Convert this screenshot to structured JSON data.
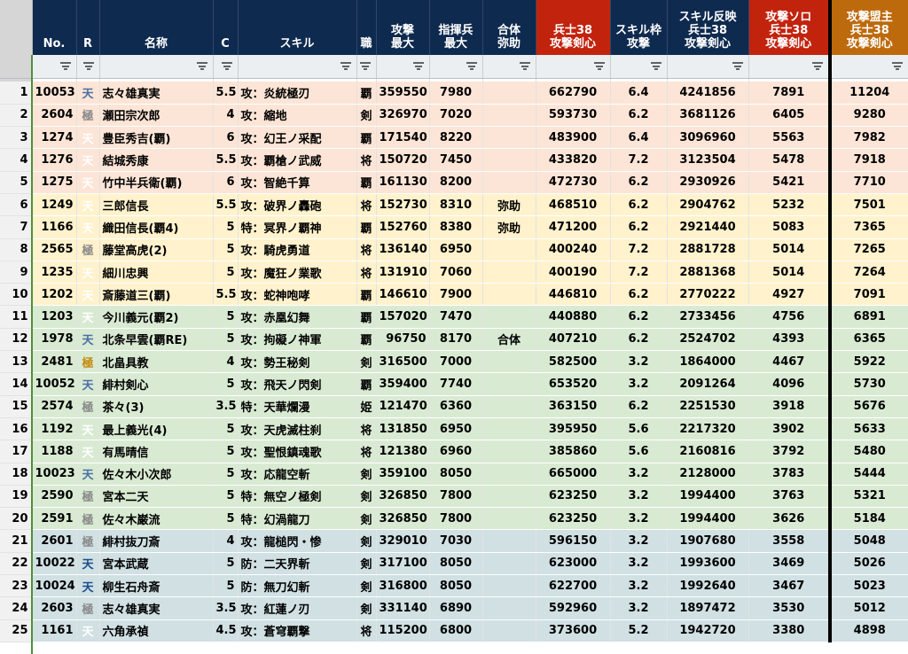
{
  "columns": [
    {
      "key": "no",
      "label": "No."
    },
    {
      "key": "r",
      "label": "R"
    },
    {
      "key": "name",
      "label": "名称"
    },
    {
      "key": "c",
      "label": "C"
    },
    {
      "key": "skill",
      "label": "スキル"
    },
    {
      "key": "job",
      "label": "職"
    },
    {
      "key": "atk_max",
      "label": "攻撃\n最大"
    },
    {
      "key": "cmd_max",
      "label": "指揮兵\n最大"
    },
    {
      "key": "combo",
      "label": "合体\n弥助"
    },
    {
      "key": "sol38",
      "label": "兵士38\n攻撃剣心"
    },
    {
      "key": "skill_slot",
      "label": "スキル枠\n攻撃"
    },
    {
      "key": "skill_reflect",
      "label": "スキル反映\n兵士38\n攻撃剣心"
    },
    {
      "key": "solo",
      "label": "攻撃ソロ\n兵士38\n攻撃剣心"
    },
    {
      "key": "alliance",
      "label": "攻撃盟主\n兵士38\n攻撃剣心"
    }
  ],
  "header_colors": {
    "default": "#0e2a4f",
    "red": "#c2230d",
    "orange": "#bd6a0d"
  },
  "rows": [
    {
      "n": "1",
      "no": "10053",
      "r": "天",
      "rs": "ten",
      "name": "志々雄真実",
      "c": "5.5",
      "skill": "攻：炎統極刃",
      "job": "覇",
      "atk": "359550",
      "cmd": "7980",
      "combo": "",
      "s38": "662790",
      "slot": "6.4",
      "refl": "4241856",
      "solo": "7891",
      "ally": "11204",
      "g": "g1"
    },
    {
      "n": "2",
      "no": "2604",
      "r": "極",
      "rs": "kyoku",
      "name": "瀬田宗次郎",
      "c": "4",
      "skill": "攻：縮地",
      "job": "剣",
      "atk": "326970",
      "cmd": "7020",
      "combo": "",
      "s38": "593730",
      "slot": "6.2",
      "refl": "3681126",
      "solo": "6405",
      "ally": "9280",
      "g": "g1"
    },
    {
      "n": "3",
      "no": "1274",
      "r": "天",
      "rs": "tenw",
      "name": "豊臣秀吉(覇)",
      "c": "6",
      "skill": "攻：幻王ノ采配",
      "job": "覇",
      "atk": "171540",
      "cmd": "8220",
      "combo": "",
      "s38": "483900",
      "slot": "6.4",
      "refl": "3096960",
      "solo": "5563",
      "ally": "7982",
      "g": "g1"
    },
    {
      "n": "4",
      "no": "1276",
      "r": "天",
      "rs": "tenw",
      "name": "結城秀康",
      "c": "5.5",
      "skill": "攻：覇槍ノ武威",
      "job": "将",
      "atk": "150720",
      "cmd": "7450",
      "combo": "",
      "s38": "433820",
      "slot": "7.2",
      "refl": "3123504",
      "solo": "5478",
      "ally": "7918",
      "g": "g1"
    },
    {
      "n": "5",
      "no": "1275",
      "r": "天",
      "rs": "tenw",
      "name": "竹中半兵衛(覇)",
      "c": "6",
      "skill": "攻：智絶千算",
      "job": "覇",
      "atk": "161130",
      "cmd": "8200",
      "combo": "",
      "s38": "472730",
      "slot": "6.2",
      "refl": "2930926",
      "solo": "5421",
      "ally": "7710",
      "g": "g1"
    },
    {
      "n": "6",
      "no": "1249",
      "r": "天",
      "rs": "tenw",
      "name": "三郎信長",
      "c": "5.5",
      "skill": "攻：破界ノ轟砲",
      "job": "将",
      "atk": "152730",
      "cmd": "8310",
      "combo": "弥助",
      "s38": "468510",
      "slot": "6.2",
      "refl": "2904762",
      "solo": "5232",
      "ally": "7501",
      "g": "g2"
    },
    {
      "n": "7",
      "no": "1166",
      "r": "天",
      "rs": "tenw",
      "name": "織田信長(覇4)",
      "c": "5",
      "skill": "特：冥界ノ覇神",
      "job": "覇",
      "atk": "152760",
      "cmd": "8380",
      "combo": "弥助",
      "s38": "471200",
      "slot": "6.2",
      "refl": "2921440",
      "solo": "5083",
      "ally": "7365",
      "g": "g2"
    },
    {
      "n": "8",
      "no": "2565",
      "r": "極",
      "rs": "kyoku",
      "name": "藤堂高虎(2)",
      "c": "5",
      "skill": "攻：騎虎勇道",
      "job": "将",
      "atk": "136140",
      "cmd": "6950",
      "combo": "",
      "s38": "400240",
      "slot": "7.2",
      "refl": "2881728",
      "solo": "5014",
      "ally": "7265",
      "g": "g2"
    },
    {
      "n": "9",
      "no": "1235",
      "r": "天",
      "rs": "tenw",
      "name": "細川忠興",
      "c": "5",
      "skill": "攻：魔狂ノ業歌",
      "job": "将",
      "atk": "131910",
      "cmd": "7060",
      "combo": "",
      "s38": "400190",
      "slot": "7.2",
      "refl": "2881368",
      "solo": "5014",
      "ally": "7264",
      "g": "g2"
    },
    {
      "n": "10",
      "no": "1202",
      "r": "天",
      "rs": "tenw",
      "name": "斎藤道三(覇)",
      "c": "5.5",
      "skill": "攻：蛇神咆哮",
      "job": "覇",
      "atk": "146610",
      "cmd": "7900",
      "combo": "",
      "s38": "446810",
      "slot": "6.2",
      "refl": "2770222",
      "solo": "4927",
      "ally": "7091",
      "g": "g2"
    },
    {
      "n": "11",
      "no": "1203",
      "r": "天",
      "rs": "tenw",
      "name": "今川義元(覇2)",
      "c": "5",
      "skill": "攻：赤凰幻舞",
      "job": "覇",
      "atk": "157020",
      "cmd": "7470",
      "combo": "",
      "s38": "440880",
      "slot": "6.2",
      "refl": "2733456",
      "solo": "4756",
      "ally": "6891",
      "g": "g3"
    },
    {
      "n": "12",
      "no": "1978",
      "r": "天",
      "rs": "ten",
      "name": "北条早雲(覇RE)",
      "c": "5",
      "skill": "攻：拘礙ノ神軍",
      "job": "覇",
      "atk": "96750",
      "cmd": "8170",
      "combo": "合体",
      "s38": "407210",
      "slot": "6.2",
      "refl": "2524702",
      "solo": "4393",
      "ally": "6365",
      "g": "g3"
    },
    {
      "n": "13",
      "no": "2481",
      "r": "極",
      "rs": "gold",
      "name": "北畠具教",
      "c": "4",
      "skill": "攻：勢王秘剣",
      "job": "剣",
      "atk": "316500",
      "cmd": "7000",
      "combo": "",
      "s38": "582500",
      "slot": "3.2",
      "refl": "1864000",
      "solo": "4467",
      "ally": "5922",
      "g": "g3"
    },
    {
      "n": "14",
      "no": "10052",
      "r": "天",
      "rs": "ten",
      "name": "緋村剣心",
      "c": "5",
      "skill": "攻：飛天ノ閃剣",
      "job": "覇",
      "atk": "359400",
      "cmd": "7740",
      "combo": "",
      "s38": "653520",
      "slot": "3.2",
      "refl": "2091264",
      "solo": "4096",
      "ally": "5730",
      "g": "g3"
    },
    {
      "n": "15",
      "no": "2574",
      "r": "極",
      "rs": "kyoku",
      "name": "茶々(3)",
      "c": "3.5",
      "skill": "特：天華爛漫",
      "job": "姫",
      "atk": "121470",
      "cmd": "6360",
      "combo": "",
      "s38": "363150",
      "slot": "6.2",
      "refl": "2251530",
      "solo": "3918",
      "ally": "5676",
      "g": "g3"
    },
    {
      "n": "16",
      "no": "1192",
      "r": "天",
      "rs": "tenw",
      "name": "最上義光(4)",
      "c": "5",
      "skill": "攻：天虎滅柱刹",
      "job": "将",
      "atk": "131850",
      "cmd": "6950",
      "combo": "",
      "s38": "395950",
      "slot": "5.6",
      "refl": "2217320",
      "solo": "3902",
      "ally": "5633",
      "g": "g3"
    },
    {
      "n": "17",
      "no": "1188",
      "r": "天",
      "rs": "tenw",
      "name": "有馬晴信",
      "c": "5",
      "skill": "攻：聖恨鎮魂歌",
      "job": "将",
      "atk": "121380",
      "cmd": "6960",
      "combo": "",
      "s38": "385860",
      "slot": "5.6",
      "refl": "2160816",
      "solo": "3792",
      "ally": "5480",
      "g": "g3"
    },
    {
      "n": "18",
      "no": "10023",
      "r": "天",
      "rs": "ten",
      "name": "佐々木小次郎",
      "c": "5",
      "skill": "攻：応龍空斬",
      "job": "剣",
      "atk": "359100",
      "cmd": "8050",
      "combo": "",
      "s38": "665000",
      "slot": "3.2",
      "refl": "2128000",
      "solo": "3783",
      "ally": "5444",
      "g": "g3"
    },
    {
      "n": "19",
      "no": "2590",
      "r": "極",
      "rs": "kyoku",
      "name": "宮本二天",
      "c": "5",
      "skill": "特：無空ノ極剣",
      "job": "剣",
      "atk": "326850",
      "cmd": "7800",
      "combo": "",
      "s38": "623250",
      "slot": "3.2",
      "refl": "1994400",
      "solo": "3763",
      "ally": "5321",
      "g": "g3"
    },
    {
      "n": "20",
      "no": "2591",
      "r": "極",
      "rs": "kyoku",
      "name": "佐々木巌流",
      "c": "5",
      "skill": "特：幻渦龍刀",
      "job": "剣",
      "atk": "326850",
      "cmd": "7800",
      "combo": "",
      "s38": "623250",
      "slot": "3.2",
      "refl": "1994400",
      "solo": "3626",
      "ally": "5184",
      "g": "g3"
    },
    {
      "n": "21",
      "no": "2601",
      "r": "極",
      "rs": "kyoku",
      "name": "緋村抜刀斎",
      "c": "4",
      "skill": "攻：龍槌閃・惨",
      "job": "剣",
      "atk": "329010",
      "cmd": "7030",
      "combo": "",
      "s38": "596150",
      "slot": "3.2",
      "refl": "1907680",
      "solo": "3558",
      "ally": "5048",
      "g": "g4"
    },
    {
      "n": "22",
      "no": "10022",
      "r": "天",
      "rs": "tend",
      "name": "宮本武蔵",
      "c": "5",
      "skill": "防：二天界斬",
      "job": "剣",
      "atk": "317100",
      "cmd": "8050",
      "combo": "",
      "s38": "623000",
      "slot": "3.2",
      "refl": "1993600",
      "solo": "3469",
      "ally": "5026",
      "g": "g4"
    },
    {
      "n": "23",
      "no": "10024",
      "r": "天",
      "rs": "tend",
      "name": "柳生石舟斎",
      "c": "5",
      "skill": "防：無刀幻斬",
      "job": "剣",
      "atk": "316800",
      "cmd": "8050",
      "combo": "",
      "s38": "622700",
      "slot": "3.2",
      "refl": "1992640",
      "solo": "3467",
      "ally": "5023",
      "g": "g4"
    },
    {
      "n": "24",
      "no": "2603",
      "r": "極",
      "rs": "kyoku",
      "name": "志々雄真実",
      "c": "3.5",
      "skill": "攻：紅蓮ノ刃",
      "job": "剣",
      "atk": "331140",
      "cmd": "6890",
      "combo": "",
      "s38": "592960",
      "slot": "3.2",
      "refl": "1897472",
      "solo": "3530",
      "ally": "5012",
      "g": "g4"
    },
    {
      "n": "25",
      "no": "1161",
      "r": "天",
      "rs": "tenw",
      "name": "六角承禎",
      "c": "4.5",
      "skill": "攻：蒼穹覇撃",
      "job": "将",
      "atk": "115200",
      "cmd": "6800",
      "combo": "",
      "s38": "373600",
      "slot": "5.2",
      "refl": "1942720",
      "solo": "3380",
      "ally": "4898",
      "g": "g4"
    }
  ]
}
